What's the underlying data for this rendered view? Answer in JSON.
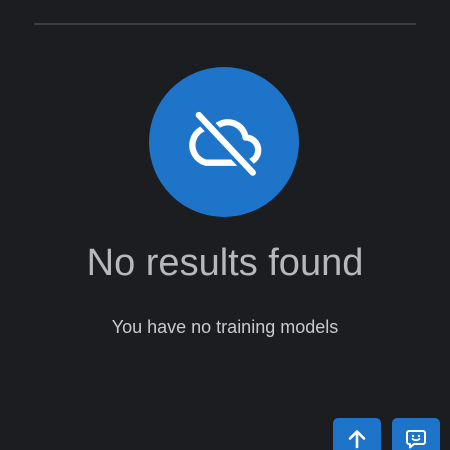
{
  "empty_state": {
    "icon": "cloud-off-icon",
    "title": "No results found",
    "message": "You have no training models"
  },
  "actions": {
    "scroll_top_icon": "arrow-up-icon",
    "feedback_icon": "feedback-icon"
  },
  "colors": {
    "background": "#1c1d20",
    "accent": "#1e74c9",
    "title_text": "#b7b8bc",
    "message_text": "#c9cacd",
    "divider": "#3b3d42"
  }
}
